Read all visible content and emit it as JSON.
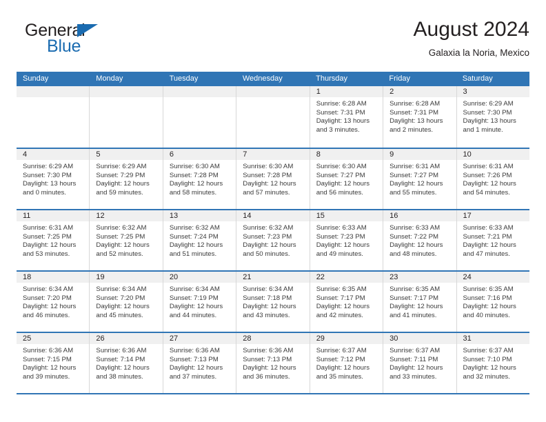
{
  "brand": {
    "word1": "General",
    "word2": "Blue",
    "triangle_icon": "blue-triangle-logo-mark",
    "color_dark": "#231f20",
    "color_blue": "#1a6bb0"
  },
  "header": {
    "title": "August 2024",
    "subtitle": "Galaxia la Noria, Mexico"
  },
  "theme": {
    "header_bar": "#3075b5",
    "day_band": "#f0f0f0",
    "cell_border": "#d7d7d7",
    "text": "#231f20"
  },
  "calendar": {
    "weekdays": [
      "Sunday",
      "Monday",
      "Tuesday",
      "Wednesday",
      "Thursday",
      "Friday",
      "Saturday"
    ],
    "weeks": [
      [
        {
          "day": "",
          "lines": []
        },
        {
          "day": "",
          "lines": []
        },
        {
          "day": "",
          "lines": []
        },
        {
          "day": "",
          "lines": []
        },
        {
          "day": "1",
          "lines": [
            "Sunrise: 6:28 AM",
            "Sunset: 7:31 PM",
            "Daylight: 13 hours",
            "and 3 minutes."
          ]
        },
        {
          "day": "2",
          "lines": [
            "Sunrise: 6:28 AM",
            "Sunset: 7:31 PM",
            "Daylight: 13 hours",
            "and 2 minutes."
          ]
        },
        {
          "day": "3",
          "lines": [
            "Sunrise: 6:29 AM",
            "Sunset: 7:30 PM",
            "Daylight: 13 hours",
            "and 1 minute."
          ]
        }
      ],
      [
        {
          "day": "4",
          "lines": [
            "Sunrise: 6:29 AM",
            "Sunset: 7:30 PM",
            "Daylight: 13 hours",
            "and 0 minutes."
          ]
        },
        {
          "day": "5",
          "lines": [
            "Sunrise: 6:29 AM",
            "Sunset: 7:29 PM",
            "Daylight: 12 hours",
            "and 59 minutes."
          ]
        },
        {
          "day": "6",
          "lines": [
            "Sunrise: 6:30 AM",
            "Sunset: 7:28 PM",
            "Daylight: 12 hours",
            "and 58 minutes."
          ]
        },
        {
          "day": "7",
          "lines": [
            "Sunrise: 6:30 AM",
            "Sunset: 7:28 PM",
            "Daylight: 12 hours",
            "and 57 minutes."
          ]
        },
        {
          "day": "8",
          "lines": [
            "Sunrise: 6:30 AM",
            "Sunset: 7:27 PM",
            "Daylight: 12 hours",
            "and 56 minutes."
          ]
        },
        {
          "day": "9",
          "lines": [
            "Sunrise: 6:31 AM",
            "Sunset: 7:27 PM",
            "Daylight: 12 hours",
            "and 55 minutes."
          ]
        },
        {
          "day": "10",
          "lines": [
            "Sunrise: 6:31 AM",
            "Sunset: 7:26 PM",
            "Daylight: 12 hours",
            "and 54 minutes."
          ]
        }
      ],
      [
        {
          "day": "11",
          "lines": [
            "Sunrise: 6:31 AM",
            "Sunset: 7:25 PM",
            "Daylight: 12 hours",
            "and 53 minutes."
          ]
        },
        {
          "day": "12",
          "lines": [
            "Sunrise: 6:32 AM",
            "Sunset: 7:25 PM",
            "Daylight: 12 hours",
            "and 52 minutes."
          ]
        },
        {
          "day": "13",
          "lines": [
            "Sunrise: 6:32 AM",
            "Sunset: 7:24 PM",
            "Daylight: 12 hours",
            "and 51 minutes."
          ]
        },
        {
          "day": "14",
          "lines": [
            "Sunrise: 6:32 AM",
            "Sunset: 7:23 PM",
            "Daylight: 12 hours",
            "and 50 minutes."
          ]
        },
        {
          "day": "15",
          "lines": [
            "Sunrise: 6:33 AM",
            "Sunset: 7:23 PM",
            "Daylight: 12 hours",
            "and 49 minutes."
          ]
        },
        {
          "day": "16",
          "lines": [
            "Sunrise: 6:33 AM",
            "Sunset: 7:22 PM",
            "Daylight: 12 hours",
            "and 48 minutes."
          ]
        },
        {
          "day": "17",
          "lines": [
            "Sunrise: 6:33 AM",
            "Sunset: 7:21 PM",
            "Daylight: 12 hours",
            "and 47 minutes."
          ]
        }
      ],
      [
        {
          "day": "18",
          "lines": [
            "Sunrise: 6:34 AM",
            "Sunset: 7:20 PM",
            "Daylight: 12 hours",
            "and 46 minutes."
          ]
        },
        {
          "day": "19",
          "lines": [
            "Sunrise: 6:34 AM",
            "Sunset: 7:20 PM",
            "Daylight: 12 hours",
            "and 45 minutes."
          ]
        },
        {
          "day": "20",
          "lines": [
            "Sunrise: 6:34 AM",
            "Sunset: 7:19 PM",
            "Daylight: 12 hours",
            "and 44 minutes."
          ]
        },
        {
          "day": "21",
          "lines": [
            "Sunrise: 6:34 AM",
            "Sunset: 7:18 PM",
            "Daylight: 12 hours",
            "and 43 minutes."
          ]
        },
        {
          "day": "22",
          "lines": [
            "Sunrise: 6:35 AM",
            "Sunset: 7:17 PM",
            "Daylight: 12 hours",
            "and 42 minutes."
          ]
        },
        {
          "day": "23",
          "lines": [
            "Sunrise: 6:35 AM",
            "Sunset: 7:17 PM",
            "Daylight: 12 hours",
            "and 41 minutes."
          ]
        },
        {
          "day": "24",
          "lines": [
            "Sunrise: 6:35 AM",
            "Sunset: 7:16 PM",
            "Daylight: 12 hours",
            "and 40 minutes."
          ]
        }
      ],
      [
        {
          "day": "25",
          "lines": [
            "Sunrise: 6:36 AM",
            "Sunset: 7:15 PM",
            "Daylight: 12 hours",
            "and 39 minutes."
          ]
        },
        {
          "day": "26",
          "lines": [
            "Sunrise: 6:36 AM",
            "Sunset: 7:14 PM",
            "Daylight: 12 hours",
            "and 38 minutes."
          ]
        },
        {
          "day": "27",
          "lines": [
            "Sunrise: 6:36 AM",
            "Sunset: 7:13 PM",
            "Daylight: 12 hours",
            "and 37 minutes."
          ]
        },
        {
          "day": "28",
          "lines": [
            "Sunrise: 6:36 AM",
            "Sunset: 7:13 PM",
            "Daylight: 12 hours",
            "and 36 minutes."
          ]
        },
        {
          "day": "29",
          "lines": [
            "Sunrise: 6:37 AM",
            "Sunset: 7:12 PM",
            "Daylight: 12 hours",
            "and 35 minutes."
          ]
        },
        {
          "day": "30",
          "lines": [
            "Sunrise: 6:37 AM",
            "Sunset: 7:11 PM",
            "Daylight: 12 hours",
            "and 33 minutes."
          ]
        },
        {
          "day": "31",
          "lines": [
            "Sunrise: 6:37 AM",
            "Sunset: 7:10 PM",
            "Daylight: 12 hours",
            "and 32 minutes."
          ]
        }
      ]
    ]
  }
}
